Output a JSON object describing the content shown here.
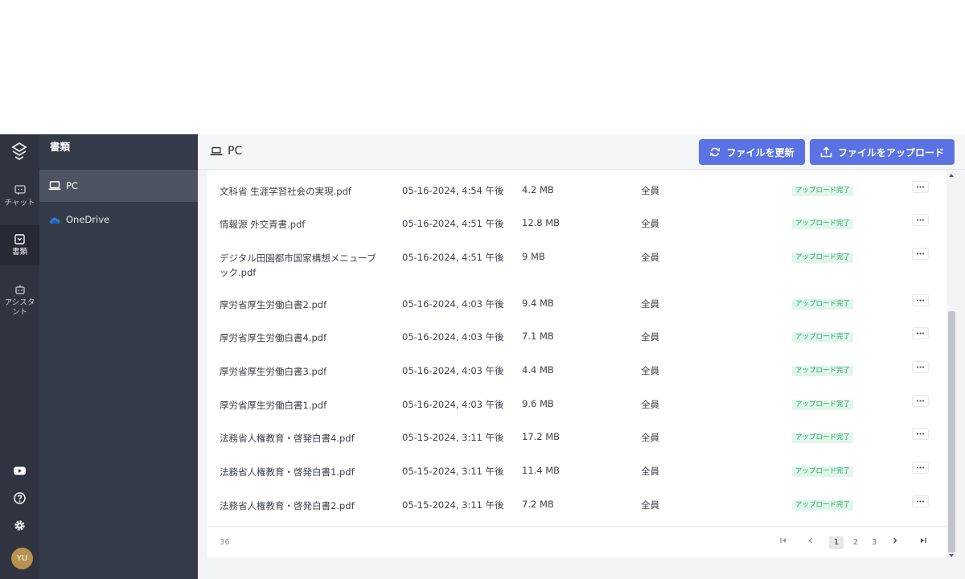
{
  "rail": {
    "items": [
      {
        "label": "チャット",
        "icon": "chat-icon"
      },
      {
        "label": "書類",
        "icon": "document-icon"
      },
      {
        "label": "アシスタント",
        "icon": "robot-icon"
      }
    ],
    "avatar": "YU"
  },
  "sidebar": {
    "title": "書類",
    "items": [
      {
        "label": "PC",
        "icon": "laptop-icon"
      },
      {
        "label": "OneDrive",
        "icon": "cloud-icon"
      }
    ]
  },
  "header": {
    "title": "PC",
    "refresh_label": "ファイルを更新",
    "upload_label": "ファイルをアップロード"
  },
  "files": [
    {
      "name": "文科省 生涯学習社会の実現.pdf",
      "date": "05-16-2024, 4:54 午後",
      "size": "4.2 MB",
      "share": "全員",
      "status": "アップロード完了"
    },
    {
      "name": "情報源 外交青書.pdf",
      "date": "05-16-2024, 4:51 午後",
      "size": "12.8 MB",
      "share": "全員",
      "status": "アップロード完了"
    },
    {
      "name": "デジタル田園都市国家構想メニューブック.pdf",
      "date": "05-16-2024, 4:51 午後",
      "size": "9 MB",
      "share": "全員",
      "status": "アップロード完了"
    },
    {
      "name": "厚労省厚生労働白書2.pdf",
      "date": "05-16-2024, 4:03 午後",
      "size": "9.4 MB",
      "share": "全員",
      "status": "アップロード完了"
    },
    {
      "name": "厚労省厚生労働白書4.pdf",
      "date": "05-16-2024, 4:03 午後",
      "size": "7.1 MB",
      "share": "全員",
      "status": "アップロード完了"
    },
    {
      "name": "厚労省厚生労働白書3.pdf",
      "date": "05-16-2024, 4:03 午後",
      "size": "4.4 MB",
      "share": "全員",
      "status": "アップロード完了"
    },
    {
      "name": "厚労省厚生労働白書1.pdf",
      "date": "05-16-2024, 4:03 午後",
      "size": "9.6 MB",
      "share": "全員",
      "status": "アップロード完了"
    },
    {
      "name": "法務省人権教育・啓発白書4.pdf",
      "date": "05-15-2024, 3:11 午後",
      "size": "17.2 MB",
      "share": "全員",
      "status": "アップロード完了"
    },
    {
      "name": "法務省人権教育・啓発白書1.pdf",
      "date": "05-15-2024, 3:11 午後",
      "size": "11.4 MB",
      "share": "全員",
      "status": "アップロード完了"
    },
    {
      "name": "法務省人権教育・啓発白書2.pdf",
      "date": "05-15-2024, 3:11 午後",
      "size": "7.2 MB",
      "share": "全員",
      "status": "アップロード完了"
    }
  ],
  "pagination": {
    "total": "36",
    "pages": [
      "1",
      "2",
      "3"
    ],
    "current": "1"
  },
  "colors": {
    "primary_button": "#5a72e4",
    "rail_bg": "#2f3440",
    "sidebar_bg": "#343a47",
    "status_bg": "#dff7ea",
    "status_text": "#2f9d63"
  }
}
